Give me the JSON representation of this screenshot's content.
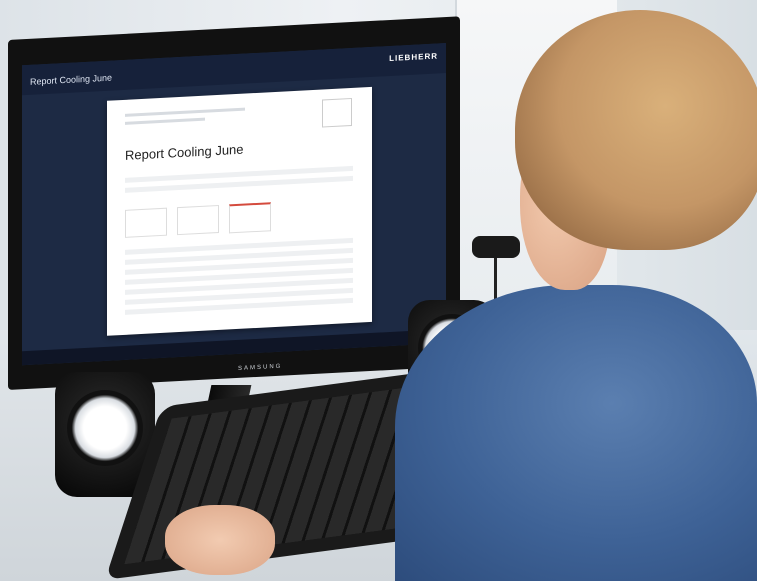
{
  "screen": {
    "app_title": "Report Cooling June",
    "brand": "LIEBHERR",
    "report_title": "Report Cooling June"
  },
  "monitor": {
    "brand": "SAMSUNG"
  },
  "colors": {
    "scrubs": "#3e6296",
    "screen_bg": "#1d2a44",
    "accent_red": "#d44b3e"
  }
}
